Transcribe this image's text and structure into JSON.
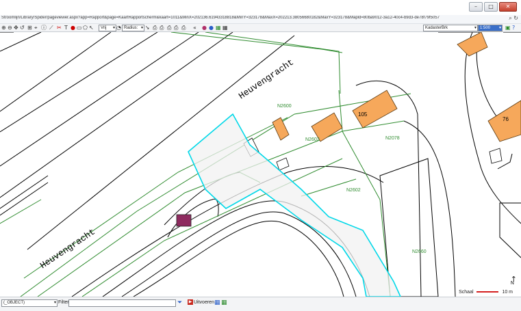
{
  "browser": {
    "url": "Stroomlijn/Library/Spider/pageviewer.aspx?app=Rapport&page=KaartRapportscherm&kaart=1011&MinX=202136.61943318818&MinY=323178&MaxX=202213.38056680182&MaxY=323178&Mapld=80ba9012-3a12-40c4-b9d3-de78f79f5057",
    "window_buttons": [
      "minimize",
      "maximize",
      "close"
    ]
  },
  "toolbar": {
    "mode_value": "Vrij",
    "radius_value": "Radius:",
    "layer_value": "KadasterBrk",
    "scale_value": "1:500"
  },
  "map": {
    "street_labels": [
      "Heuvengracht",
      "Heuvengracht"
    ],
    "parcel_labels": [
      "N2600",
      "N2602",
      "N2078",
      "N2602",
      "N2660"
    ],
    "house_numbers": [
      "105",
      "76"
    ],
    "colors": {
      "building_fill": "#f6a85b",
      "parcel_line": "#2e8b2e",
      "selection": "#00d8e8",
      "marker": "#8e2b5f"
    }
  },
  "scale": {
    "label": "Schaal",
    "value": "10 m"
  },
  "north_label": "N",
  "filterbar": {
    "object_select_value": "(_OBJECT)",
    "filter_label": "Filter",
    "filter_value": "",
    "run_label": "Uitvoeren"
  }
}
